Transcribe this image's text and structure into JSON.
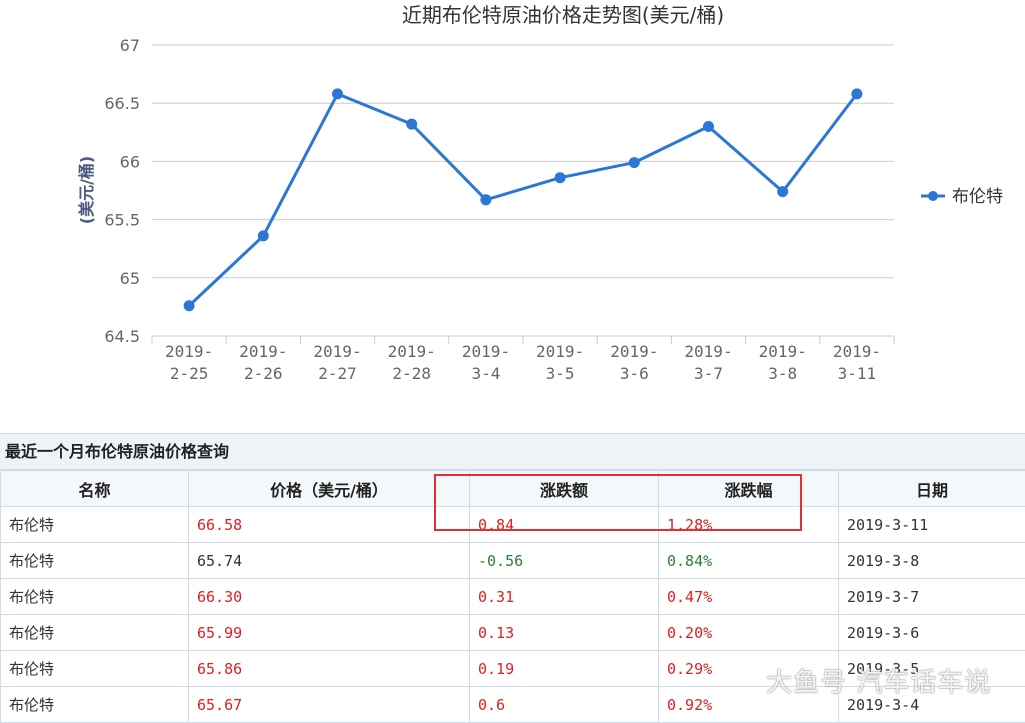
{
  "chart_data": {
    "type": "line",
    "title": "近期布伦特原油价格走势图(美元/桶)",
    "ylabel": "(美元/桶)",
    "xlabel": "",
    "categories": [
      "2019-2-25",
      "2019-2-26",
      "2019-2-27",
      "2019-2-28",
      "2019-3-4",
      "2019-3-5",
      "2019-3-6",
      "2019-3-7",
      "2019-3-8",
      "2019-3-11"
    ],
    "category_lines": [
      [
        "2019-",
        "2-25"
      ],
      [
        "2019-",
        "2-26"
      ],
      [
        "2019-",
        "2-27"
      ],
      [
        "2019-",
        "2-28"
      ],
      [
        "2019-",
        "3-4"
      ],
      [
        "2019-",
        "3-5"
      ],
      [
        "2019-",
        "3-6"
      ],
      [
        "2019-",
        "3-7"
      ],
      [
        "2019-",
        "3-8"
      ],
      [
        "2019-",
        "3-11"
      ]
    ],
    "series": [
      {
        "name": "布伦特",
        "values": [
          64.76,
          65.36,
          66.58,
          66.32,
          65.67,
          65.86,
          65.99,
          66.3,
          65.74,
          66.58
        ]
      }
    ],
    "ylim": [
      64.5,
      67
    ],
    "yticks": [
      "64.5",
      "65",
      "65.5",
      "66",
      "66.5",
      "67"
    ],
    "grid": true,
    "legend": "right",
    "color": "#2b78d4"
  },
  "table": {
    "title": "最近一个月布伦特原油价格查询",
    "headers": [
      "名称",
      "价格（美元/桶）",
      "涨跌额",
      "涨跌幅",
      "日期"
    ],
    "rows": [
      {
        "name": "布伦特",
        "price": "66.58",
        "change": "0.84",
        "pct": "1.28%",
        "date": "2019-3-11",
        "dir": "up"
      },
      {
        "name": "布伦特",
        "price": "65.74",
        "change": "-0.56",
        "pct": "0.84%",
        "date": "2019-3-8",
        "dir": "down"
      },
      {
        "name": "布伦特",
        "price": "66.30",
        "change": "0.31",
        "pct": "0.47%",
        "date": "2019-3-7",
        "dir": "up"
      },
      {
        "name": "布伦特",
        "price": "65.99",
        "change": "0.13",
        "pct": "0.20%",
        "date": "2019-3-6",
        "dir": "up"
      },
      {
        "name": "布伦特",
        "price": "65.86",
        "change": "0.19",
        "pct": "0.29%",
        "date": "2019-3-5",
        "dir": "up"
      },
      {
        "name": "布伦特",
        "price": "65.67",
        "change": "0.6",
        "pct": "0.92%",
        "date": "2019-3-4",
        "dir": "up"
      }
    ],
    "colors": {
      "up": "#e02020",
      "down": "#2e7d32"
    }
  },
  "watermark": "大鱼号 汽车话车说"
}
